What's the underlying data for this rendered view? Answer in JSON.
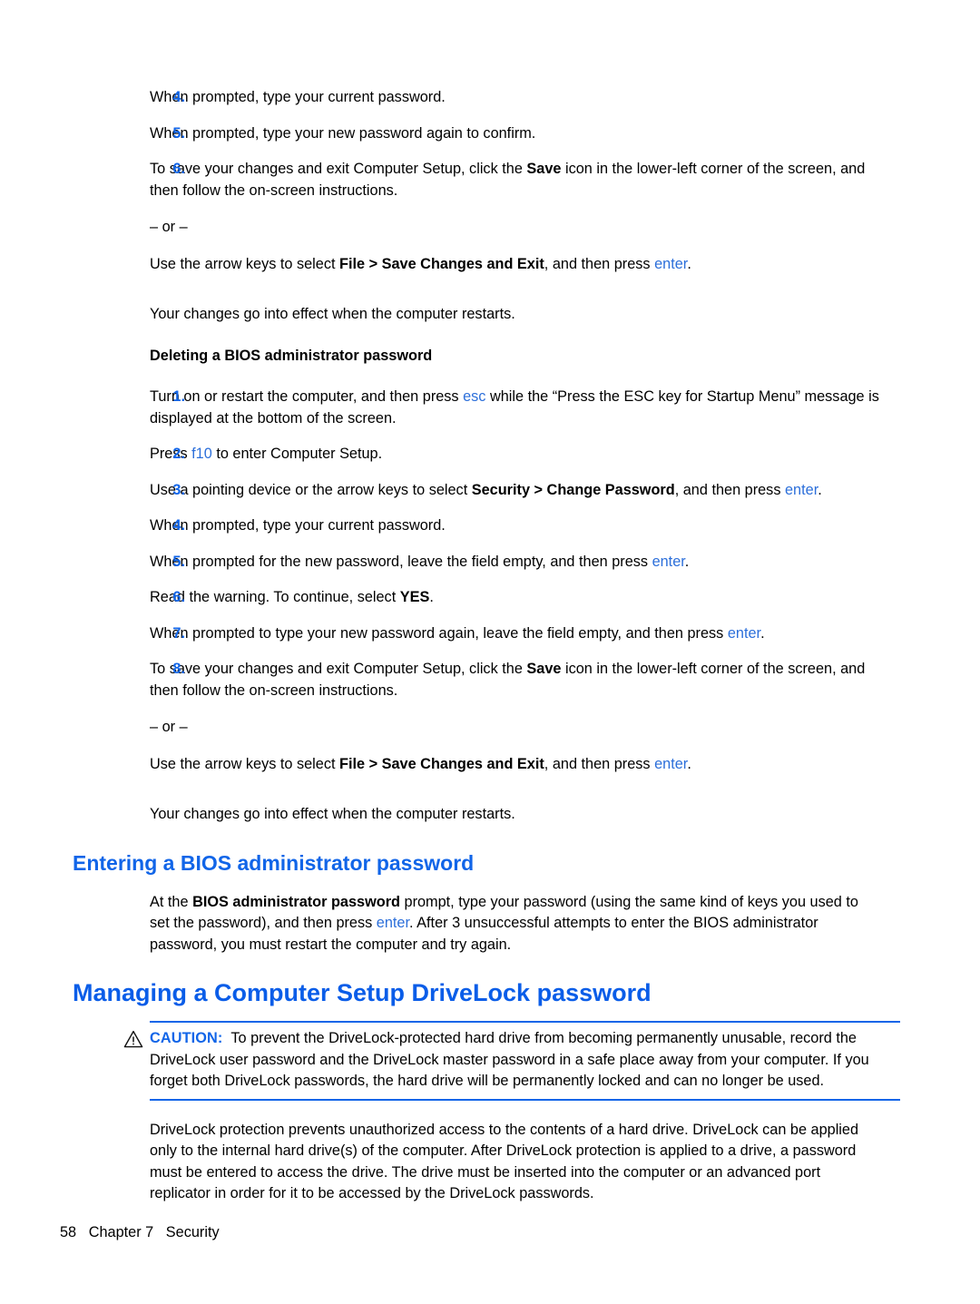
{
  "page": {
    "footer_page_number": "58",
    "footer_chapter": "Chapter 7",
    "footer_section": "Security"
  },
  "colors": {
    "heading_blue": "#0A5DE8",
    "subheading_blue": "#1165E8",
    "list_number_blue": "#1165E8",
    "key_blue": "#2C6FDA",
    "rule_blue": "#1165E8",
    "body_black": "#000000"
  },
  "list_changing": {
    "items": [
      {
        "number": "4.",
        "text": "When prompted, type your current password."
      },
      {
        "number": "5.",
        "text": "When prompted, type your new password again to confirm."
      },
      {
        "number": "6.",
        "text_before_bold": "To save your changes and exit Computer Setup, click the ",
        "bold": "Save",
        "text_after_bold": " icon in the lower-left corner of the screen, and then follow the on-screen instructions.",
        "or_separator": "– or –",
        "alt_before_bold": "Use the arrow keys to select ",
        "alt_bold": "File > Save Changes and Exit",
        "alt_after_bold": ", and then press ",
        "alt_key": "enter",
        "alt_end": "."
      }
    ]
  },
  "restart_note_1": "Your changes go into effect when the computer restarts.",
  "deleting_heading": "Deleting a BIOS administrator password",
  "list_deleting": {
    "items": [
      {
        "number": "1.",
        "text_a": "Turn on or restart the computer, and then press ",
        "key": "esc",
        "text_b": " while the “Press the ESC key for Startup Menu” message is displayed at the bottom of the screen."
      },
      {
        "number": "2.",
        "text_a": "Press ",
        "key": "f10",
        "text_b": " to enter Computer Setup."
      },
      {
        "number": "3.",
        "text_a": "Use a pointing device or the arrow keys to select ",
        "bold": "Security > Change Password",
        "text_b": ", and then press ",
        "key": "enter",
        "text_c": "."
      },
      {
        "number": "4.",
        "text_a": "When prompted, type your current password."
      },
      {
        "number": "5.",
        "text_a": "When prompted for the new password, leave the field empty, and then press ",
        "key": "enter",
        "text_c": "."
      },
      {
        "number": "6.",
        "text_a": "Read the warning. To continue, select ",
        "bold": "YES",
        "text_c": "."
      },
      {
        "number": "7.",
        "text_a": "When prompted to type your new password again, leave the field empty, and then press ",
        "key": "enter",
        "text_c": "."
      },
      {
        "number": "8.",
        "text_before_bold": "To save your changes and exit Computer Setup, click the ",
        "bold": "Save",
        "text_after_bold": " icon in the lower-left corner of the screen, and then follow the on-screen instructions.",
        "or_separator": "– or –",
        "alt_before_bold": "Use the arrow keys to select ",
        "alt_bold": "File > Save Changes and Exit",
        "alt_after_bold": ", and then press ",
        "alt_key": "enter",
        "alt_end": "."
      }
    ]
  },
  "restart_note_2": "Your changes go into effect when the computer restarts.",
  "entering_section": {
    "heading": "Entering a BIOS administrator password",
    "para_a": "At the ",
    "para_bold": "BIOS administrator password",
    "para_b": " prompt, type your password (using the same kind of keys you used to set the password), and then press ",
    "para_key": "enter",
    "para_c": ". After 3 unsuccessful attempts to enter the BIOS administrator password, you must restart the computer and try again."
  },
  "drivelock_section": {
    "heading": "Managing a Computer Setup DriveLock password",
    "caution_icon": "warning-triangle-icon",
    "caution_label": "CAUTION:",
    "caution_text": "To prevent the DriveLock-protected hard drive from becoming permanently unusable, record the DriveLock user password and the DriveLock master password in a safe place away from your computer. If you forget both DriveLock passwords, the hard drive will be permanently locked and can no longer be used.",
    "para": "DriveLock protection prevents unauthorized access to the contents of a hard drive. DriveLock can be applied only to the internal hard drive(s) of the computer. After DriveLock protection is applied to a drive, a password must be entered to access the drive. The drive must be inserted into the computer or an advanced port replicator in order for it to be accessed by the DriveLock passwords."
  }
}
